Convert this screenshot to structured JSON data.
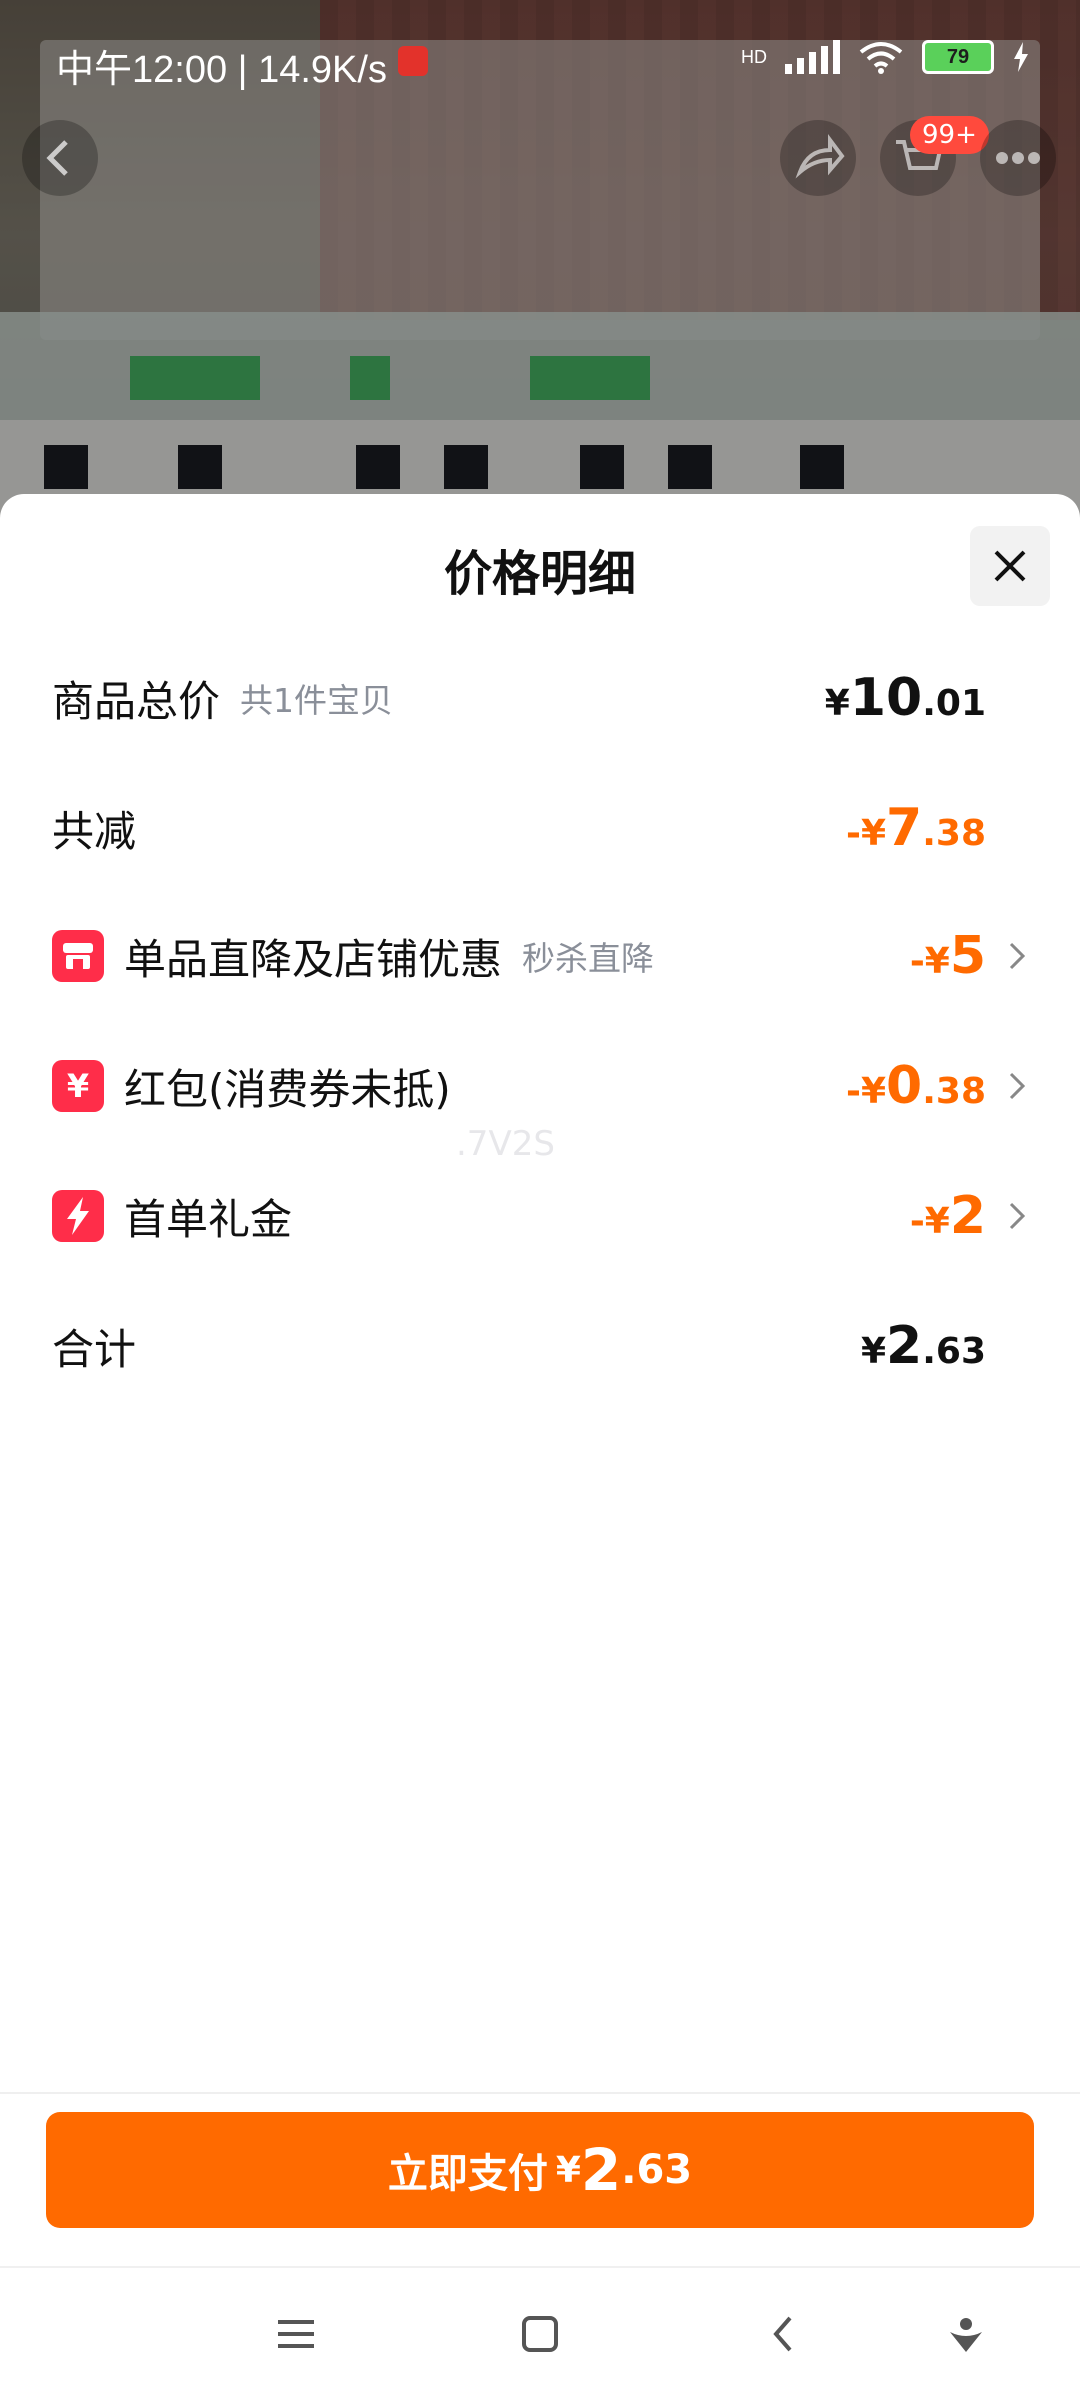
{
  "status_bar": {
    "time": "中午12:00 | 14.9K/s",
    "battery": "79",
    "network": "HD"
  },
  "background": {
    "cart_badge": "99+"
  },
  "sheet": {
    "title": "价格明细",
    "rows": [
      {
        "label": "商品总价",
        "sub": "共1件宝贝",
        "sym": "¥",
        "int": "10",
        "dec": ".01"
      },
      {
        "label": "共减",
        "sym": "-¥",
        "int": "7",
        "dec": ".38"
      },
      {
        "label": "单品直降及店铺优惠",
        "sub": "秒杀直降",
        "sym": "-¥",
        "int": "5",
        "dec": "",
        "icon": "store-icon"
      },
      {
        "label": "红包(消费券未抵)",
        "sym": "-¥",
        "int": "0",
        "dec": ".38",
        "icon": "red-packet-icon"
      },
      {
        "label": "首单礼金",
        "sym": "-¥",
        "int": "2",
        "dec": "",
        "icon": "lightning-icon"
      },
      {
        "label": "合计",
        "sym": "¥",
        "int": "2",
        "dec": ".63"
      }
    ],
    "watermark": ".7V2S"
  },
  "pay_button": {
    "label": "立即支付",
    "sym": "¥",
    "int": "2",
    "dec": ".63"
  },
  "colors": {
    "accent": "#ff6a00",
    "icon_red": "#ff2d49"
  }
}
